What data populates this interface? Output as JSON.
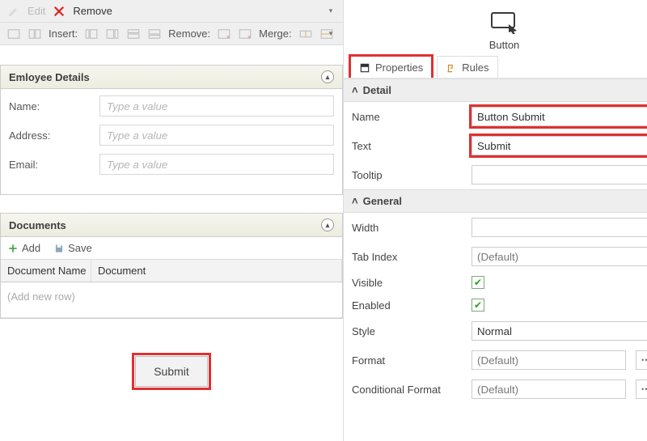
{
  "toolbar_top": {
    "edit_label": "Edit",
    "remove_label": "Remove"
  },
  "toolbar_sec": {
    "insert_label": "Insert:",
    "remove_label": "Remove:",
    "merge_label": "Merge:"
  },
  "panel_employee": {
    "title": "Emloyee Details",
    "name_label": "Name:",
    "address_label": "Address:",
    "email_label": "Email:",
    "placeholder": "Type a value"
  },
  "panel_docs": {
    "title": "Documents",
    "add_label": "Add",
    "save_label": "Save",
    "col_name": "Document Name",
    "col_doc": "Document",
    "add_row_hint": "(Add new row)"
  },
  "submit": {
    "label": "Submit"
  },
  "inspector": {
    "element_type": "Button",
    "tabs": {
      "properties": "Properties",
      "rules": "Rules"
    },
    "sections": {
      "detail": "Detail",
      "general": "General"
    },
    "fields": {
      "name": {
        "label": "Name",
        "value": "Button Submit"
      },
      "text": {
        "label": "Text",
        "value": "Submit"
      },
      "tooltip": {
        "label": "Tooltip",
        "value": ""
      },
      "width": {
        "label": "Width",
        "value": ""
      },
      "tab_index": {
        "label": "Tab Index",
        "value": "(Default)"
      },
      "visible": {
        "label": "Visible",
        "value": true
      },
      "enabled": {
        "label": "Enabled",
        "value": true
      },
      "style": {
        "label": "Style",
        "value": "Normal"
      },
      "format": {
        "label": "Format",
        "value": "(Default)"
      },
      "conditional_format": {
        "label": "Conditional Format",
        "value": "(Default)"
      }
    }
  }
}
